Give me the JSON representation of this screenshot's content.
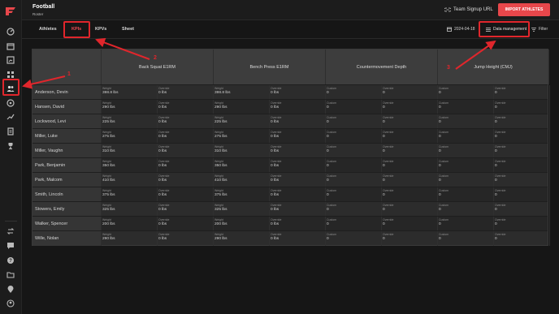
{
  "app": {
    "title": "Football",
    "subtitle": "Roster",
    "team_signup_label": "Team Signup URL",
    "import_label": "IMPORT ATHLETES",
    "brand_color": "#e8474b"
  },
  "tabs": [
    {
      "label": "Athletes",
      "active": false
    },
    {
      "label": "KPIs",
      "active": true
    },
    {
      "label": "KPVs",
      "active": false
    },
    {
      "label": "Sheet",
      "active": false
    }
  ],
  "toolbar": {
    "date": "2024-04-18",
    "data_management_label": "Data management",
    "filter_label": "Filter"
  },
  "sidebar": {
    "icons": [
      "logo-icon",
      "dashboard-icon",
      "calendar-icon",
      "chart-icon",
      "grid-icon",
      "roster-icon",
      "soccer-ball-icon",
      "trend-icon",
      "clipboard-icon",
      "trophy-icon",
      "swap-icon",
      "chat-icon",
      "help-icon",
      "folder-icon",
      "location-icon",
      "user-icon"
    ],
    "active_icon": "roster-icon"
  },
  "table": {
    "groups": [
      "Back Squat E1RM",
      "Bench Press E1RM",
      "Countermovement Depth",
      "Jump Height (CMJ)"
    ],
    "sub_labels": [
      [
        "Weight",
        "Override"
      ],
      [
        "Weight",
        "Override"
      ],
      [
        "Custom",
        "Override"
      ],
      [
        "Custom",
        "Override"
      ]
    ],
    "rows": [
      {
        "name": "Anderson, Devin",
        "values": [
          "398.8 lbs",
          "0 lbs",
          "398.8 lbs",
          "0 lbs",
          "0",
          "0",
          "0",
          "0"
        ]
      },
      {
        "name": "Hansen, David",
        "values": [
          "290 lbs",
          "0 lbs",
          "290 lbs",
          "0 lbs",
          "0",
          "0",
          "0",
          "0"
        ]
      },
      {
        "name": "Lockwood, Levi",
        "values": [
          "225 lbs",
          "0 lbs",
          "225 lbs",
          "0 lbs",
          "0",
          "0",
          "0",
          "0"
        ]
      },
      {
        "name": "Miller, Luke",
        "values": [
          "275 lbs",
          "0 lbs",
          "275 lbs",
          "0 lbs",
          "0",
          "0",
          "0",
          "0"
        ]
      },
      {
        "name": "Miller, Vaughn",
        "values": [
          "310 lbs",
          "0 lbs",
          "310 lbs",
          "0 lbs",
          "0",
          "0",
          "0",
          "0"
        ]
      },
      {
        "name": "Park, Benjamin",
        "values": [
          "350 lbs",
          "0 lbs",
          "350 lbs",
          "0 lbs",
          "0",
          "0",
          "0",
          "0"
        ]
      },
      {
        "name": "Park, Malcom",
        "values": [
          "410 lbs",
          "0 lbs",
          "410 lbs",
          "0 lbs",
          "0",
          "0",
          "0",
          "0"
        ]
      },
      {
        "name": "Smith, Lincoln",
        "values": [
          "375 lbs",
          "0 lbs",
          "375 lbs",
          "0 lbs",
          "0",
          "0",
          "0",
          "0"
        ]
      },
      {
        "name": "Stowers, Emily",
        "values": [
          "325 lbs",
          "0 lbs",
          "325 lbs",
          "0 lbs",
          "0",
          "0",
          "0",
          "0"
        ]
      },
      {
        "name": "Walker, Spencer",
        "values": [
          "200 lbs",
          "0 lbs",
          "200 lbs",
          "0 lbs",
          "0",
          "0",
          "0",
          "0"
        ]
      },
      {
        "name": "Wille, Nolan",
        "values": [
          "290 lbs",
          "0 lbs",
          "290 lbs",
          "0 lbs",
          "0",
          "0",
          "0",
          "0"
        ]
      }
    ]
  },
  "annotations": {
    "labels": [
      "1",
      "2",
      "3"
    ],
    "color": "#e0262c"
  }
}
